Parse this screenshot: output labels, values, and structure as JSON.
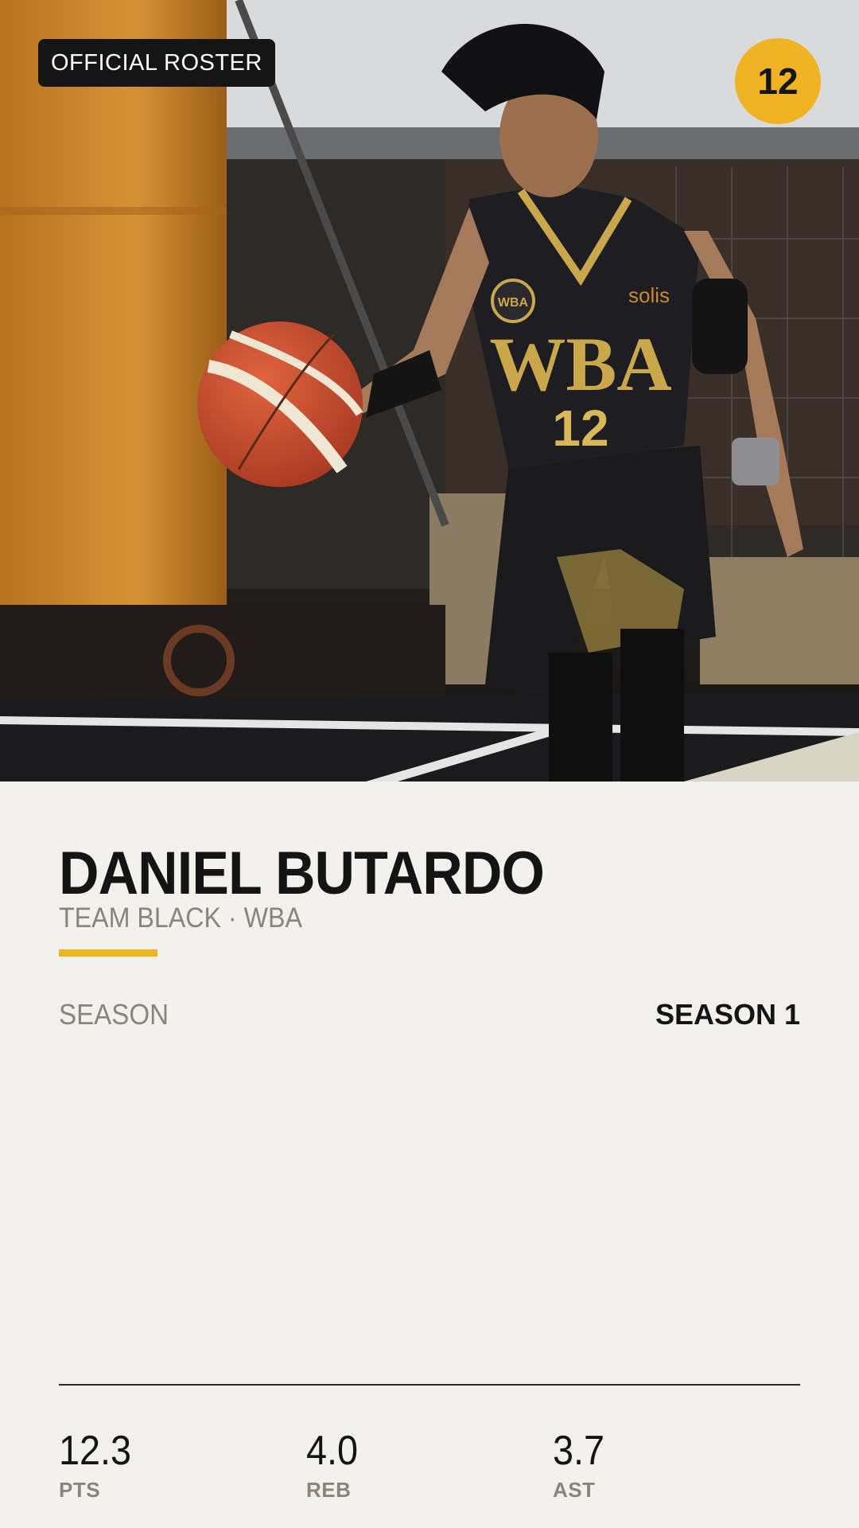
{
  "header": {
    "roster_label": "OFFICIAL ROSTER",
    "jersey_number": "12"
  },
  "player": {
    "name": "DANIEL BUTARDO",
    "team_line": "TEAM BLACK · WBA"
  },
  "season": {
    "label": "SEASON",
    "value": "SEASON 1"
  },
  "stats": [
    {
      "value": "12.3",
      "label": "PTS"
    },
    {
      "value": "4.0",
      "label": "REB"
    },
    {
      "value": "3.7",
      "label": "AST"
    }
  ],
  "jersey": {
    "text": "WBA",
    "number": "12",
    "badge": "WBA",
    "sponsor": "solis"
  },
  "colors": {
    "accent": "#f0b323",
    "background": "#f2f1ed",
    "text_dark": "#141414",
    "text_muted": "#8c8479"
  }
}
